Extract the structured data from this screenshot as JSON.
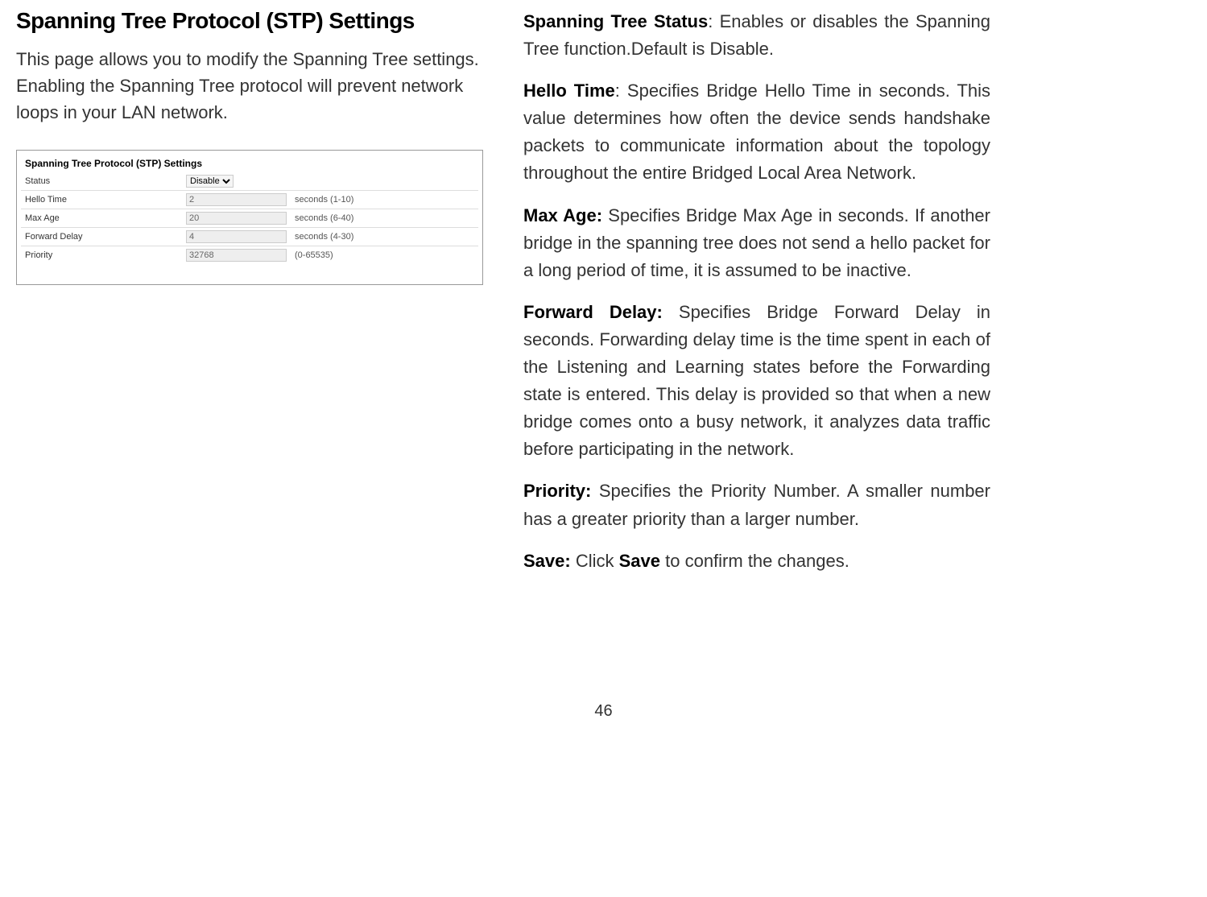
{
  "left": {
    "heading": "Spanning Tree Protocol (STP) Settings",
    "intro": "This page allows you to modify the Spanning Tree settings. Enabling the Spanning Tree protocol will prevent network loops in your LAN network.",
    "panel": {
      "title": "Spanning Tree Protocol (STP) Settings",
      "rows": [
        {
          "label": "Status",
          "value": "Disable",
          "note": "",
          "type": "select"
        },
        {
          "label": "Hello Time",
          "value": "2",
          "note": "seconds (1-10)",
          "type": "input"
        },
        {
          "label": "Max Age",
          "value": "20",
          "note": "seconds (6-40)",
          "type": "input"
        },
        {
          "label": "Forward Delay",
          "value": "4",
          "note": "seconds (4-30)",
          "type": "input"
        },
        {
          "label": "Priority",
          "value": "32768",
          "note": "(0-65535)",
          "type": "input"
        }
      ]
    }
  },
  "right": {
    "defs": [
      {
        "term": "Spanning Tree Status",
        "sep": ": ",
        "text": "Enables or disables the Spanning Tree function.Default is Disable."
      },
      {
        "term": "Hello Time",
        "sep": ": ",
        "text": "Specifies Bridge Hello Time in seconds. This value determines how often the device sends handshake packets to communicate information about the topology throughout the entire Bridged Local Area Network."
      },
      {
        "term": "Max Age:",
        "sep": " ",
        "text": "Specifies Bridge Max Age in seconds. If another bridge in the spanning tree does not send a hello packet for a long period of time, it is assumed to be inactive."
      },
      {
        "term": "Forward Delay:",
        "sep": " ",
        "text": "Specifies Bridge Forward Delay in seconds. Forwarding delay time is the time spent in each of the Listening and Learning states before the Forwarding state is entered. This delay is provided so that when a new bridge comes onto a busy network, it analyzes data traffic before participating in the network."
      },
      {
        "term": "Priority:",
        "sep": " ",
        "text": "Specifies the Priority Number. A smaller number has a greater priority than a larger number."
      },
      {
        "term": "Save:",
        "sep": " ",
        "text_pre": "Click ",
        "bold": "Save",
        "text_post": " to confirm the changes."
      }
    ]
  },
  "page_number": "46"
}
